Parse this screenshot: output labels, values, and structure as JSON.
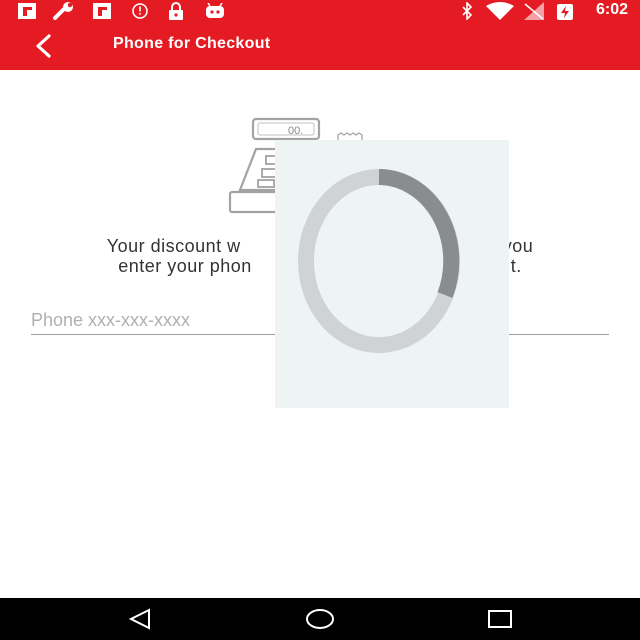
{
  "status_bar": {
    "time": "6:02",
    "left_icons": [
      "flipboard-icon",
      "wrench-icon",
      "flipboard-icon",
      "alarm-icon",
      "lock-icon",
      "android-icon"
    ],
    "right_icons": [
      "bluetooth-icon",
      "wifi-icon",
      "no-signal-icon",
      "battery-charging-icon"
    ]
  },
  "app_bar": {
    "title": "Phone for Checkout",
    "back_icon": "chevron-left-icon"
  },
  "content": {
    "illustration_icon": "cash-register-icon",
    "register_display": "00.",
    "message": "Your discount w… you enter your phon… out.",
    "message_line1_left": "Your discount w",
    "message_line1_right": "you",
    "message_line2_left": "enter your phon",
    "message_line2_right": "out.",
    "phone_placeholder": "Phone xxx-xxx-xxxx",
    "phone_value": ""
  },
  "overlay": {
    "type": "loading-spinner"
  },
  "nav_bar": {
    "buttons": [
      "back-triangle-icon",
      "home-circle-icon",
      "recents-square-icon"
    ]
  },
  "colors": {
    "brand_red": "#e51b23",
    "overlay_bg": "#eef4f4",
    "spinner_track": "#cfd3d3",
    "spinner_arc": "#8a8d8d"
  }
}
